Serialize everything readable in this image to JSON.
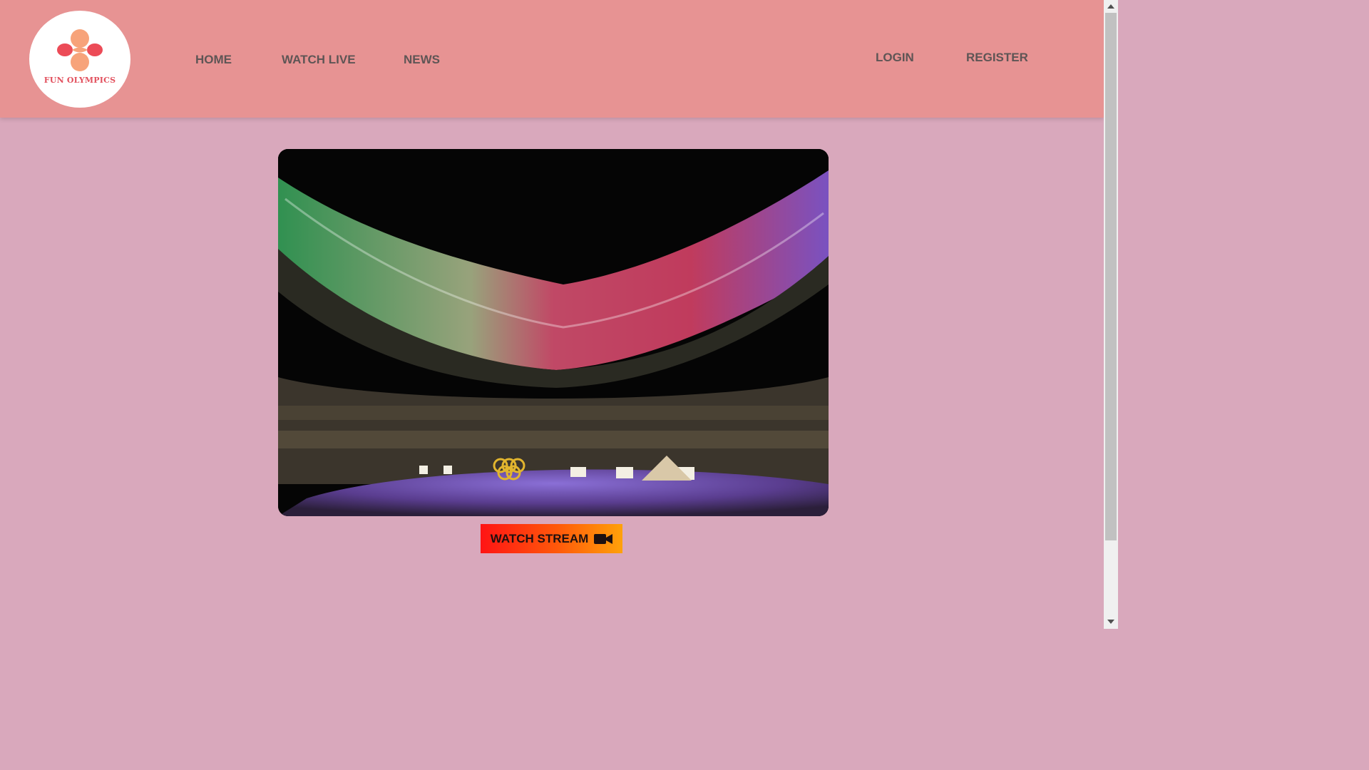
{
  "brand": {
    "name": "FUN OLYMPICS"
  },
  "nav": {
    "home": "HOME",
    "watch_live": "WATCH LIVE",
    "news": "NEWS"
  },
  "auth": {
    "login": "LOGIN",
    "register": "REGISTER"
  },
  "cta": {
    "label": "WATCH STREAM",
    "icon": "video-camera-icon"
  },
  "colors": {
    "header": "#e79393",
    "background": "#d9a8bc",
    "nav_text": "#5e5555",
    "brand_red": "#e2505d",
    "brand_orange": "#f7a37a"
  }
}
